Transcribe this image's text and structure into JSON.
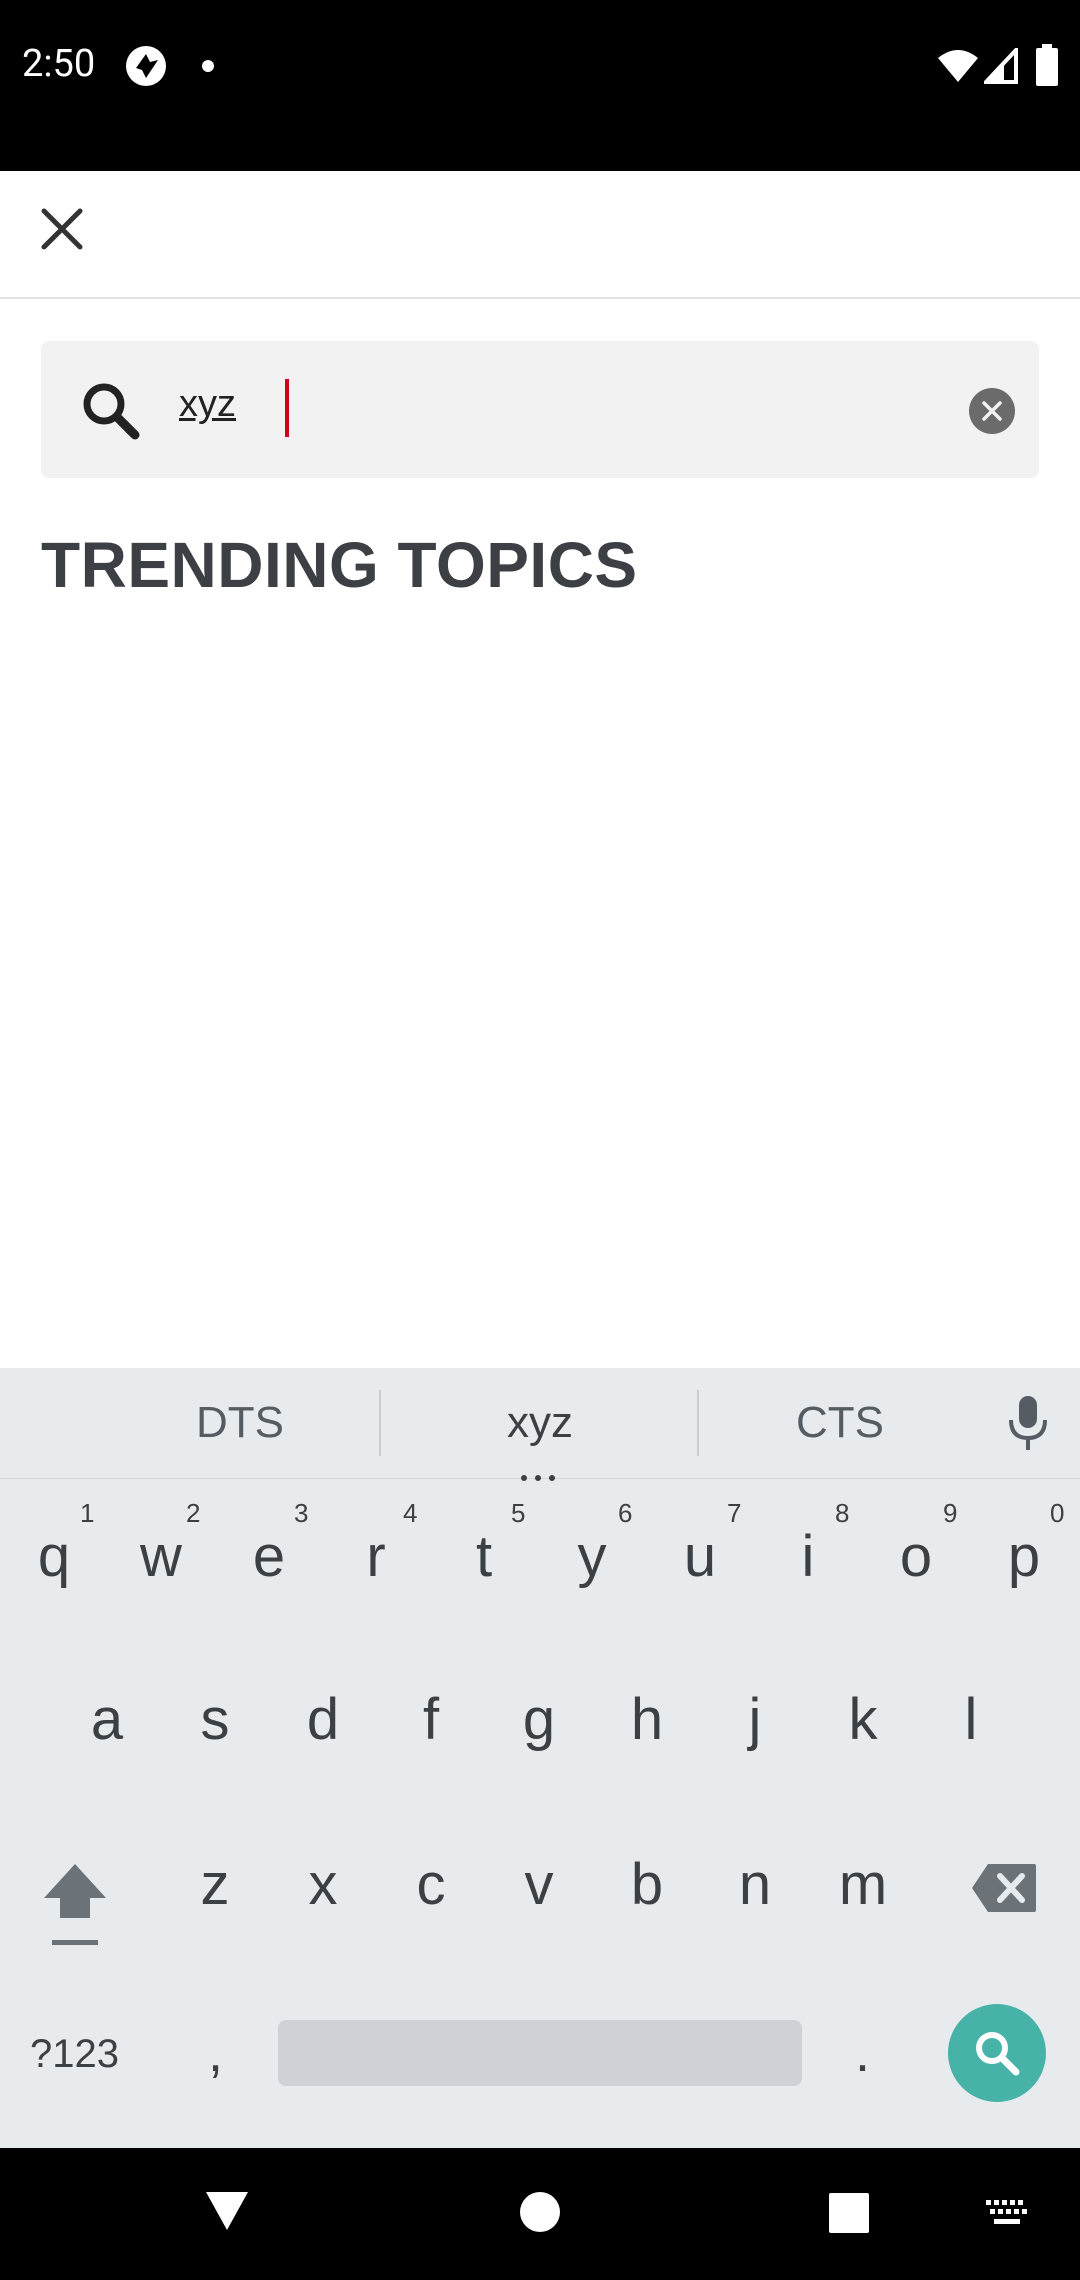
{
  "status_bar": {
    "time": "2:50"
  },
  "search": {
    "query": "xyz"
  },
  "section_title": "TRENDING TOPICS",
  "keyboard": {
    "suggestions": [
      "DTS",
      "xyz",
      "CTS"
    ],
    "row1": [
      {
        "key": "q",
        "num": "1"
      },
      {
        "key": "w",
        "num": "2"
      },
      {
        "key": "e",
        "num": "3"
      },
      {
        "key": "r",
        "num": "4"
      },
      {
        "key": "t",
        "num": "5"
      },
      {
        "key": "y",
        "num": "6"
      },
      {
        "key": "u",
        "num": "7"
      },
      {
        "key": "i",
        "num": "8"
      },
      {
        "key": "o",
        "num": "9"
      },
      {
        "key": "p",
        "num": "0"
      }
    ],
    "row2": [
      "a",
      "s",
      "d",
      "f",
      "g",
      "h",
      "j",
      "k",
      "l"
    ],
    "row3": [
      "z",
      "x",
      "c",
      "v",
      "b",
      "n",
      "m"
    ],
    "symbols_label": "?123",
    "comma": ",",
    "period": "."
  }
}
